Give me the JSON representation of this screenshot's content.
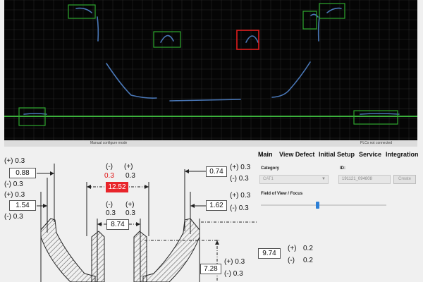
{
  "status": {
    "mode": "Manual configure mode",
    "plc": "PLCs not connected"
  },
  "tabs": [
    {
      "label": "Main",
      "active": true
    },
    {
      "label": "View Defect",
      "active": false
    },
    {
      "label": "Initial Setup",
      "active": false
    },
    {
      "label": "Service",
      "active": false
    },
    {
      "label": "Integration",
      "active": false
    }
  ],
  "category": {
    "label": "Category",
    "value": "CAT1"
  },
  "id_field": {
    "label": "ID:",
    "value": "191121_094808"
  },
  "create_button": "Create",
  "fov": {
    "label": "Field of View / Focus",
    "level": 0.45
  },
  "measurements": {
    "m1": {
      "value": "0.88",
      "plus": "(+) 0.3",
      "minus": "(-) 0.3"
    },
    "m2": {
      "value": "1.54",
      "plus": "(+) 0.3",
      "minus": "(-) 0.3"
    },
    "m3": {
      "value": "12.52",
      "plus_sign": "(+)",
      "plus_val": "0.3",
      "minus_sign": "(-)",
      "minus_val": "0.3"
    },
    "m4": {
      "value": "8.74",
      "plus_sign": "(+)",
      "plus_val": "0.3",
      "minus_sign": "(-)",
      "minus_val": "0.3"
    },
    "m5": {
      "value": "0.74",
      "plus": "(+) 0.3",
      "minus": "(-) 0.3"
    },
    "m6": {
      "value": "1.62",
      "plus": "(+) 0.3",
      "minus": "(-) 0.3"
    },
    "m7": {
      "value": "9.74",
      "plus_sign": "(+)",
      "plus_val": "0.2",
      "minus_sign": "(-)",
      "minus_val": "0.2"
    },
    "m8": {
      "value": "7.28",
      "plus": "(+) 0.3",
      "minus": "(-) 0.3"
    }
  },
  "colors": {
    "scan_bg": "#050505",
    "grid": "#2a2a2a",
    "profile": "#4a78b8",
    "roi_ok": "#2ea82e",
    "roi_fail": "#e01e1e",
    "baseline": "#3cb03c",
    "fail_value": "#e8242a",
    "slider": "#2c7fd6"
  }
}
